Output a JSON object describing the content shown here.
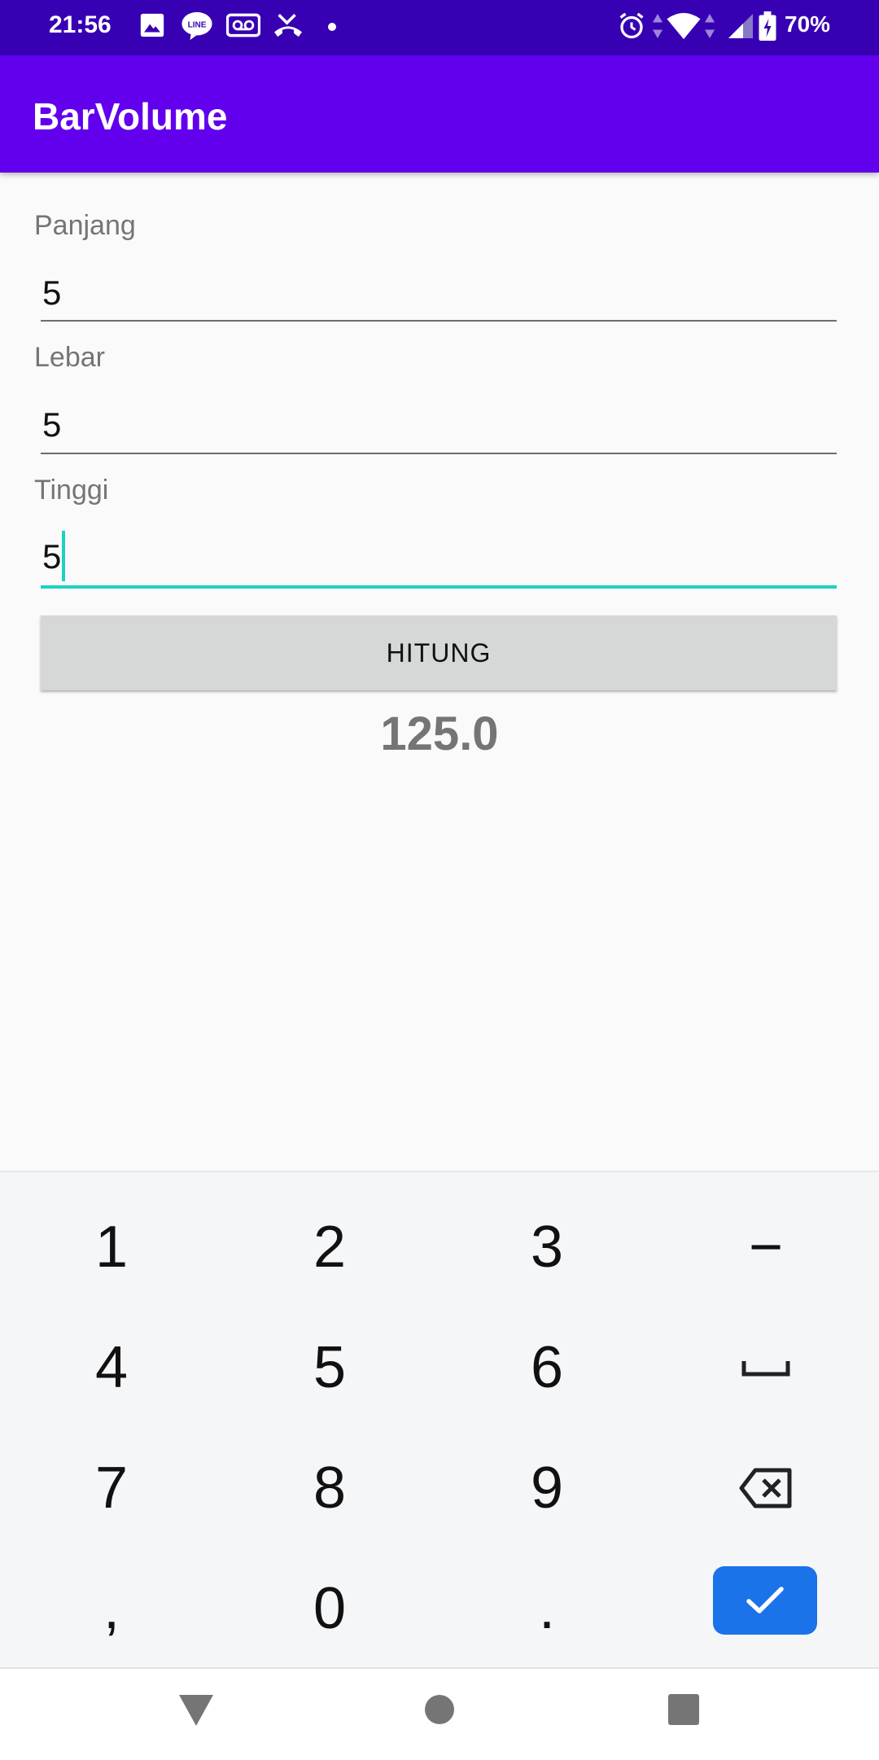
{
  "status_bar": {
    "time": "21:56",
    "battery": "70%"
  },
  "app_bar": {
    "title": "BarVolume"
  },
  "form": {
    "panjang": {
      "label": "Panjang",
      "value": "5"
    },
    "lebar": {
      "label": "Lebar",
      "value": "5"
    },
    "tinggi": {
      "label": "Tinggi",
      "value": "5"
    },
    "button_label": "HITUNG",
    "result": "125.0"
  },
  "keyboard": {
    "keys": [
      "1",
      "2",
      "3",
      "−",
      "4",
      "5",
      "6",
      "space",
      "7",
      "8",
      "9",
      "backspace",
      ",",
      "0",
      ".",
      "done"
    ]
  },
  "colors": {
    "status_bar": "#3700b3",
    "app_bar": "#6200ee",
    "accent": "#1ed1c1",
    "keyboard_done": "#1a73e8"
  }
}
